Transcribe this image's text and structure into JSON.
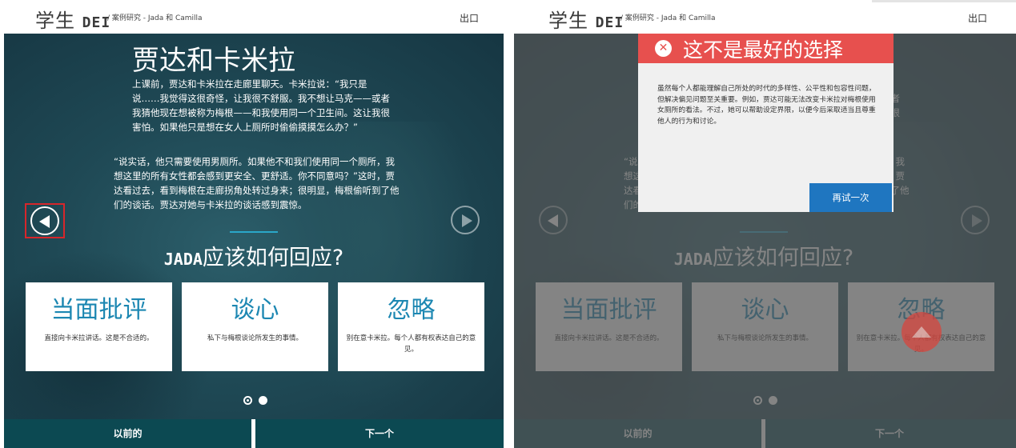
{
  "brand": {
    "name": "学生",
    "suffix": "DEI"
  },
  "breadcrumb": "/ 案例研究 - Jada 和 Camilla",
  "exit_label": "出口",
  "story": {
    "title": "贾达和卡米拉",
    "paragraph1": "上课前，贾达和卡米拉在走廊里聊天。卡米拉说：“我只是说……我觉得这很奇怪，让我很不舒服。我不想让马克——或者我猜他现在想被称为梅根——和我使用同一个卫生间。这让我很害怕。如果他只是想在女人上厕所时偷偷摸摸怎么办？”",
    "paragraph2": "“说实话，他只需要使用男厕所。如果他不和我们使用同一个厕所，我想这里的所有女性都会感到更安全、更舒适。你不同意吗？”这时，贾达看过去，看到梅根在走廊拐角处转过身来；很明显，梅根偷听到了他们的谈话。贾达对她与卡米拉的谈话感到震惊。"
  },
  "question": {
    "prefix": "JADA",
    "text": "应该如何回应?"
  },
  "options": [
    {
      "title": "当面批评",
      "desc": "直接向卡米拉讲话。这是不合适的。"
    },
    {
      "title": "谈心",
      "desc": "私下与梅根谈论所发生的事情。"
    },
    {
      "title": "忽略",
      "desc": "别在意卡米拉。每个人都有权表达自己的意见。"
    }
  ],
  "bottom_nav": {
    "prev": "以前的",
    "next": "下一个"
  },
  "feedback": {
    "title": "这不是最好的选择",
    "body": "虽然每个人都能理解自己所处的时代的多样性、公平性和包容性问题，但解决偏见问题至关重要。例如，贾达可能无法改变卡米拉对梅根使用女厕所的看法。不过，她可以帮助设定界限，以便今后采取适当且尊重他人的行为和讨论。",
    "retry_label": "再试一次",
    "icon": "close-icon"
  },
  "colors": {
    "accent": "#1c87b2",
    "nav_bar": "#0c4952",
    "error_header": "#e7504e",
    "retry_button": "#1f76c0",
    "highlight_border": "#d7262b"
  }
}
